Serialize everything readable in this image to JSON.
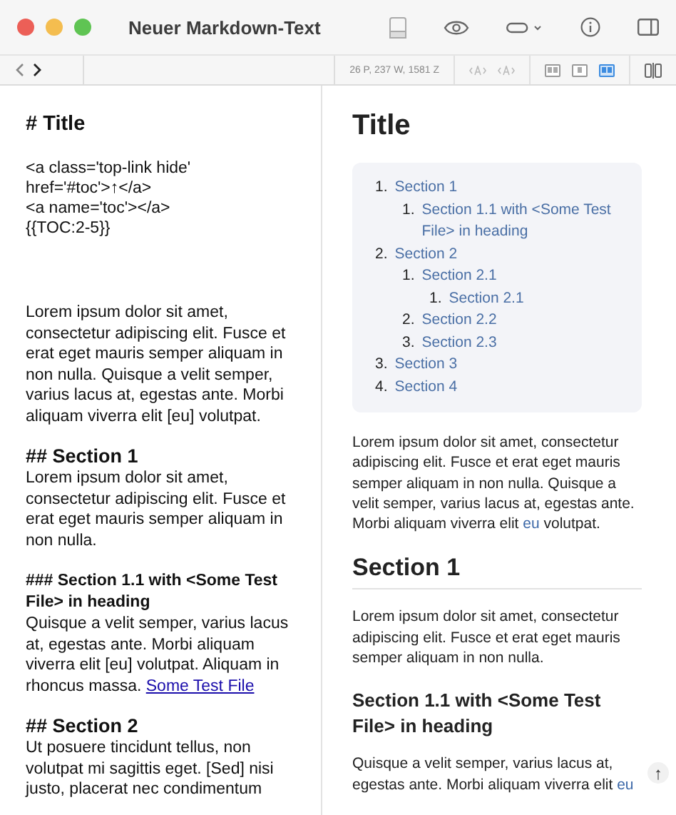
{
  "window": {
    "title": "Neuer Markdown-Text"
  },
  "toolbar": {
    "stats": "26 P, 237 W, 1581 Z",
    "views": [
      {
        "selected": false
      },
      {
        "selected": false
      },
      {
        "selected": true
      }
    ]
  },
  "editor": {
    "blocks": [
      {
        "kind": "h1",
        "text": "# Title"
      },
      {
        "kind": "code",
        "lines": [
          "<a class='top-link hide'",
          "href='#toc'>↑</a>",
          "<a name='toc'></a>",
          "{{TOC:2-5}}"
        ]
      },
      {
        "kind": "p",
        "parts": [
          {
            "text": "Lorem ipsum dolor sit amet, consectetur adipiscing elit. Fusce et erat eget mauris semper aliquam in non nulla. Quisque a velit semper, varius lacus at, egestas ante. Morbi aliquam viverra elit [eu] volutpat.",
            "link": false
          }
        ]
      },
      {
        "kind": "h2",
        "text": "## Section 1"
      },
      {
        "kind": "p",
        "parts": [
          {
            "text": "Lorem ipsum dolor sit amet, consectetur adipiscing elit. Fusce et erat eget mauris semper aliquam in non nulla.",
            "link": false
          }
        ]
      },
      {
        "kind": "h3",
        "text": "### Section 1.1 with <Some Test File> in heading"
      },
      {
        "kind": "p",
        "parts": [
          {
            "text": "Quisque a velit semper, varius lacus at, egestas ante. Morbi aliquam viverra elit [eu] volutpat. Aliquam in rhoncus massa. ",
            "link": false
          },
          {
            "text": "Some Test File",
            "link": true
          }
        ]
      },
      {
        "kind": "h2",
        "text": "## Section 2"
      },
      {
        "kind": "p",
        "parts": [
          {
            "text": "Ut posuere tincidunt tellus, non volutpat mi sagittis eget. [Sed] nisi justo, placerat nec condimentum",
            "link": false
          }
        ]
      }
    ]
  },
  "preview": {
    "blocks": [
      {
        "kind": "h1",
        "text": "Title"
      },
      {
        "kind": "toc",
        "items": [
          {
            "number": "1.",
            "text": "Section 1",
            "children": [
              {
                "number": "1.",
                "text": "Section 1.1 with <Some Test File> in heading"
              }
            ]
          },
          {
            "number": "2.",
            "text": "Section 2",
            "children": [
              {
                "number": "1.",
                "text": "Section 2.1",
                "children": [
                  {
                    "number": "1.",
                    "text": "Section 2.1"
                  }
                ]
              },
              {
                "number": "2.",
                "text": "Section 2.2"
              },
              {
                "number": "3.",
                "text": "Section 2.3"
              }
            ]
          },
          {
            "number": "3.",
            "text": "Section 3"
          },
          {
            "number": "4.",
            "text": "Section 4"
          }
        ]
      },
      {
        "kind": "p",
        "parts": [
          {
            "text": "Lorem ipsum dolor sit amet, consectetur adipiscing elit. Fusce et erat eget mauris semper aliquam in non nulla. Quisque a velit semper, varius lacus at, egestas ante. Morbi aliquam viverra elit ",
            "link": false
          },
          {
            "text": "eu",
            "link": true
          },
          {
            "text": " volutpat.",
            "link": false
          }
        ]
      },
      {
        "kind": "h2",
        "text": "Section 1"
      },
      {
        "kind": "p",
        "parts": [
          {
            "text": "Lorem ipsum dolor sit amet, consectetur adipiscing elit. Fusce et erat eget mauris semper aliquam in non nulla.",
            "link": false
          }
        ]
      },
      {
        "kind": "h3",
        "text": "Section 1.1 with <Some Test File> in heading"
      },
      {
        "kind": "p",
        "parts": [
          {
            "text": "Quisque a velit semper, varius lacus at, egestas ante. Morbi aliquam viverra elit ",
            "link": false
          },
          {
            "text": "eu",
            "link": true
          }
        ]
      }
    ],
    "scroll_top": "↑"
  }
}
